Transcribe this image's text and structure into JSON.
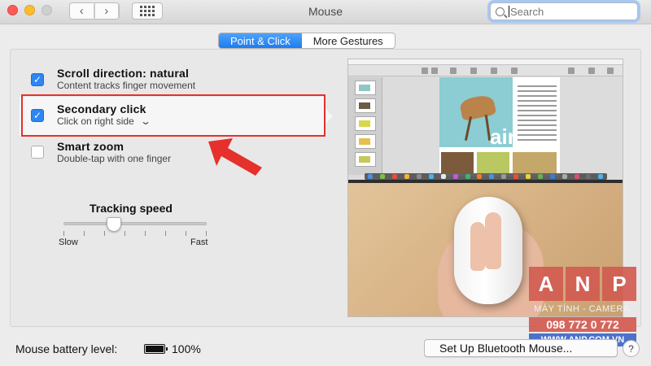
{
  "window": {
    "title": "Mouse"
  },
  "search": {
    "placeholder": "Search"
  },
  "tabs": [
    {
      "label": "Point & Click",
      "active": true
    },
    {
      "label": "More Gestures",
      "active": false
    }
  ],
  "options": [
    {
      "title": "Scroll direction: natural",
      "subtitle": "Content tracks finger movement",
      "checked": true
    },
    {
      "title": "Secondary click",
      "subtitle": "Click on right side",
      "checked": true,
      "has_dropdown": true
    },
    {
      "title": "Smart zoom",
      "subtitle": "Double-tap with one finger",
      "checked": false
    }
  ],
  "tracking": {
    "label": "Tracking speed",
    "min_label": "Slow",
    "max_label": "Fast",
    "level": 0.35
  },
  "preview": {
    "doc_word": "airs"
  },
  "footer": {
    "battery_label": "Mouse battery level:",
    "battery_value": "100%",
    "bluetooth_button": "Set Up Bluetooth Mouse...",
    "help": "?"
  },
  "watermark": {
    "letters": [
      "A",
      "N",
      "P"
    ],
    "tagline": "MÁY TÍNH - CAMERA",
    "phone": "098 772 0 772",
    "url": "WWW.ANP.COM.VN"
  },
  "colors": {
    "accent": "#2d86f2",
    "highlight_frame": "#e5302c",
    "annotation_arrow": "#e5302c"
  }
}
